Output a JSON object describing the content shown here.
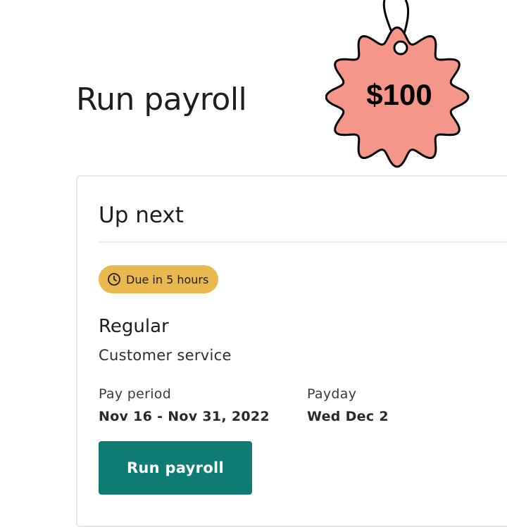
{
  "page": {
    "title": "Run payroll"
  },
  "card": {
    "title": "Up next",
    "badge": {
      "text": "Due in 5 hours",
      "icon": "clock-icon",
      "color": "#e9b94f"
    },
    "run_type": "Regular",
    "department": "Customer service",
    "pay_period": {
      "label": "Pay period",
      "value": "Nov 16 - Nov 31, 2022"
    },
    "payday": {
      "label": "Payday",
      "value": "Wed Dec 2"
    },
    "button": {
      "label": "Run payroll",
      "color": "#0f7c74"
    }
  },
  "price_tag": {
    "text": "$100",
    "color": "#f4968a"
  }
}
